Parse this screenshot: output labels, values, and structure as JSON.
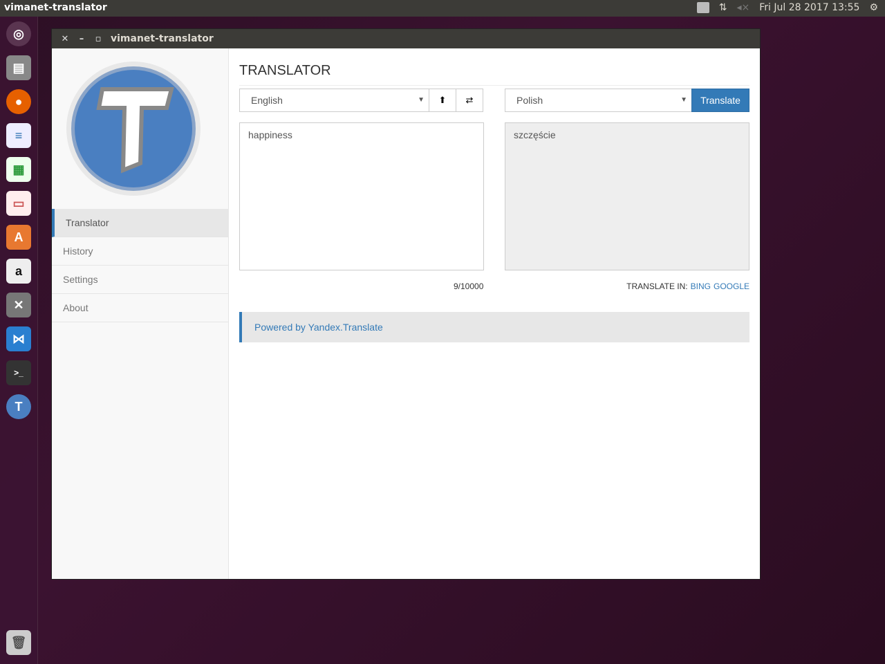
{
  "topbar": {
    "app_title": "vimanet-translator",
    "datetime": "Fri Jul 28 2017 13:55"
  },
  "window": {
    "title": "vimanet-translator"
  },
  "sidebar": {
    "items": [
      {
        "label": "Translator"
      },
      {
        "label": "History"
      },
      {
        "label": "Settings"
      },
      {
        "label": "About"
      }
    ]
  },
  "main": {
    "heading": "TRANSLATOR",
    "source_lang": "English",
    "target_lang": "Polish",
    "translate_label": "Translate",
    "input_text": "happiness",
    "output_text": "szczęście",
    "char_count": "9/10000",
    "translate_in_label": "TRANSLATE IN:",
    "bing_label": "BING",
    "google_label": "GOOGLE",
    "powered_by": "Powered by Yandex.Translate"
  },
  "colors": {
    "accent": "#337ab7"
  }
}
